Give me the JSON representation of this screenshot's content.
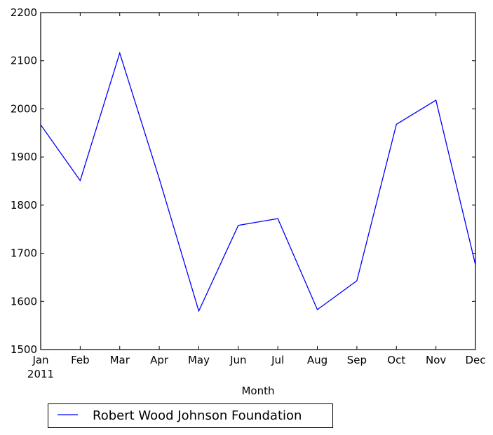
{
  "chart_data": {
    "type": "line",
    "title": "",
    "xlabel": "Month",
    "ylabel": "",
    "categories": [
      "Jan",
      "Feb",
      "Mar",
      "Apr",
      "May",
      "Jun",
      "Jul",
      "Aug",
      "Sep",
      "Oct",
      "Nov",
      "Dec"
    ],
    "x_sublabel": "2011",
    "ylim": [
      1500,
      2200
    ],
    "yticks": [
      1500,
      1600,
      1700,
      1800,
      1900,
      2000,
      2100,
      2200
    ],
    "grid": false,
    "legend_position": "below-left",
    "series": [
      {
        "name": "Robert Wood Johnson Foundation",
        "color": "#0000ff",
        "values": [
          1967,
          1851,
          2116,
          1855,
          1580,
          1758,
          1772,
          1583,
          1643,
          1968,
          2018,
          1676
        ]
      }
    ]
  }
}
